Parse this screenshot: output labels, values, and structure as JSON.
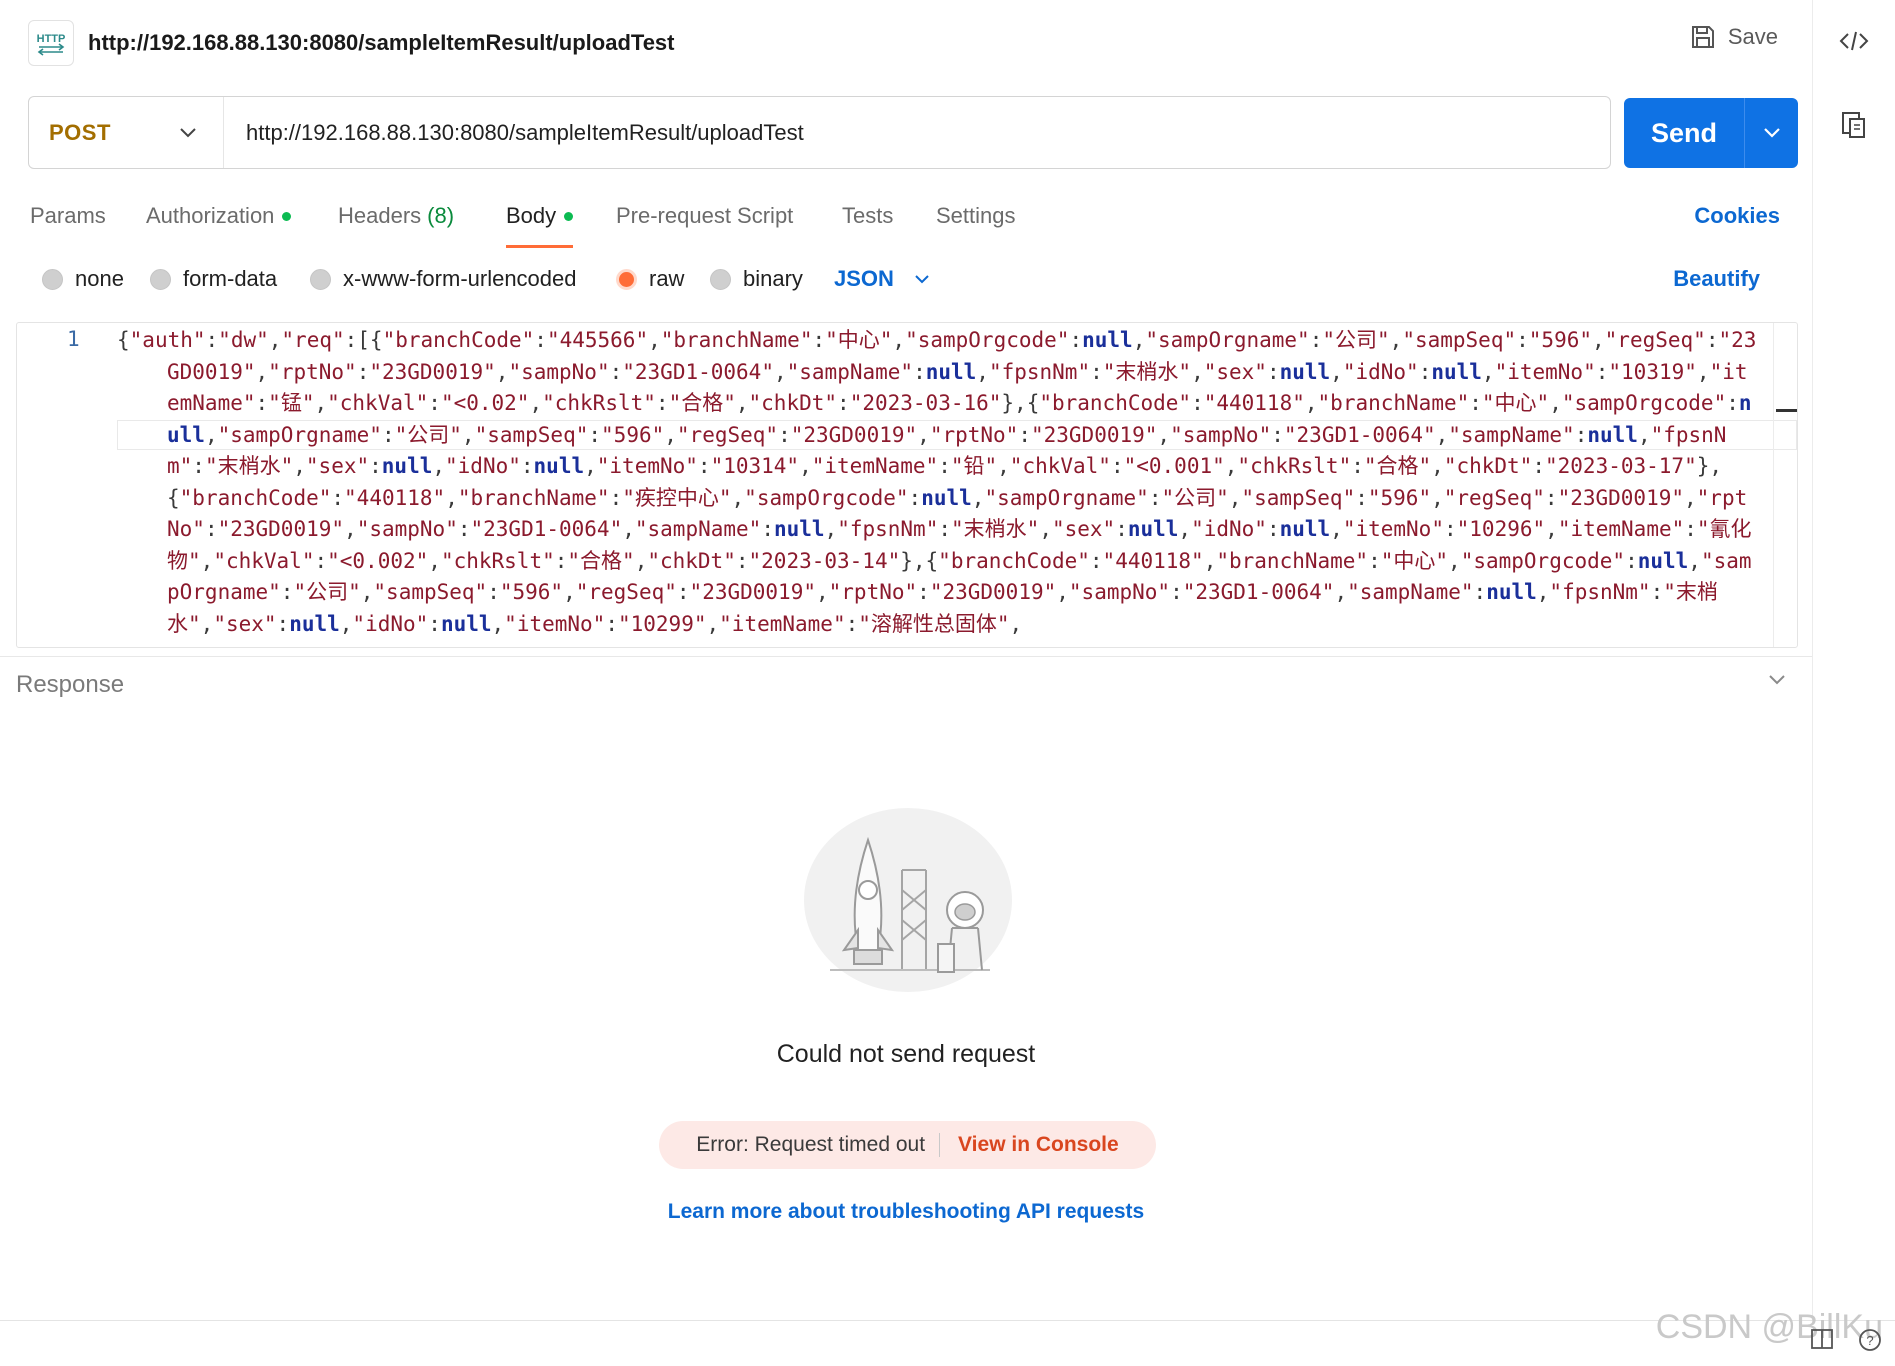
{
  "request": {
    "title": "http://192.168.88.130:8080/sampleItemResult/uploadTest",
    "badge": "HTTP",
    "save_label": "Save",
    "method": "POST",
    "url": "http://192.168.88.130:8080/sampleItemResult/uploadTest",
    "send_label": "Send"
  },
  "tabs": {
    "params": "Params",
    "authorization": "Authorization",
    "headers": "Headers",
    "headers_count": "(8)",
    "body": "Body",
    "prerequest": "Pre-request Script",
    "tests": "Tests",
    "settings": "Settings",
    "cookies": "Cookies"
  },
  "body_types": {
    "none": "none",
    "form_data": "form-data",
    "urlencoded": "x-www-form-urlencoded",
    "raw": "raw",
    "binary": "binary",
    "format": "JSON",
    "beautify": "Beautify"
  },
  "editor": {
    "line_number": "1",
    "segments": [
      {
        "t": "{",
        "c": "pn"
      },
      {
        "t": "\"auth\"",
        "c": "s"
      },
      {
        "t": ":",
        "c": "pn"
      },
      {
        "t": "\"dw\"",
        "c": "s"
      },
      {
        "t": ",",
        "c": "pn"
      },
      {
        "t": "\"req\"",
        "c": "s"
      },
      {
        "t": ":[{",
        "c": "pn"
      },
      {
        "t": "\"branchCode\"",
        "c": "s"
      },
      {
        "t": ":",
        "c": "pn"
      },
      {
        "t": "\"445566\"",
        "c": "s"
      },
      {
        "t": ",",
        "c": "pn"
      },
      {
        "t": "\"branchName\"",
        "c": "s"
      },
      {
        "t": ":",
        "c": "pn"
      },
      {
        "t": "\"中心\"",
        "c": "s"
      },
      {
        "t": ",",
        "c": "pn"
      },
      {
        "t": "\"sampOrgcode\"",
        "c": "s"
      },
      {
        "t": ":",
        "c": "pn"
      },
      {
        "t": "null",
        "c": "kw"
      },
      {
        "t": ",",
        "c": "pn"
      },
      {
        "t": "\"sampOrgname\"",
        "c": "s"
      },
      {
        "t": ":",
        "c": "pn"
      },
      {
        "t": "\"公司\"",
        "c": "s"
      },
      {
        "t": ",",
        "c": "pn"
      },
      {
        "t": "\"sampSeq\"",
        "c": "s"
      },
      {
        "t": ":",
        "c": "pn"
      },
      {
        "t": "\"596\"",
        "c": "s"
      },
      {
        "t": ",",
        "c": "pn"
      },
      {
        "t": "\"regSeq\"",
        "c": "s"
      },
      {
        "t": ":",
        "c": "pn"
      },
      {
        "t": "\"23GD0019\"",
        "c": "s"
      },
      {
        "t": ",",
        "c": "pn"
      },
      {
        "t": "\"rptNo\"",
        "c": "s"
      },
      {
        "t": ":",
        "c": "pn"
      },
      {
        "t": "\"23GD0019\"",
        "c": "s"
      },
      {
        "t": ",",
        "c": "pn"
      },
      {
        "t": "\"sampNo\"",
        "c": "s"
      },
      {
        "t": ":",
        "c": "pn"
      },
      {
        "t": "\"23GD1-0064\"",
        "c": "s"
      },
      {
        "t": ",",
        "c": "pn"
      },
      {
        "t": "\"sampName\"",
        "c": "s"
      },
      {
        "t": ":",
        "c": "pn"
      },
      {
        "t": "null",
        "c": "kw"
      },
      {
        "t": ",",
        "c": "pn"
      },
      {
        "t": "\"fpsnNm\"",
        "c": "s"
      },
      {
        "t": ":",
        "c": "pn"
      },
      {
        "t": "\"末梢水\"",
        "c": "s"
      },
      {
        "t": ",",
        "c": "pn"
      },
      {
        "t": "\"sex\"",
        "c": "s"
      },
      {
        "t": ":",
        "c": "pn"
      },
      {
        "t": "null",
        "c": "kw"
      },
      {
        "t": ",",
        "c": "pn"
      },
      {
        "t": "\"idNo\"",
        "c": "s"
      },
      {
        "t": ":",
        "c": "pn"
      },
      {
        "t": "null",
        "c": "kw"
      },
      {
        "t": ",",
        "c": "pn"
      },
      {
        "t": "\"itemNo\"",
        "c": "s"
      },
      {
        "t": ":",
        "c": "pn"
      },
      {
        "t": "\"10319\"",
        "c": "s"
      },
      {
        "t": ",",
        "c": "pn"
      },
      {
        "t": "\"itemName\"",
        "c": "s"
      },
      {
        "t": ":",
        "c": "pn"
      },
      {
        "t": "\"锰\"",
        "c": "s"
      },
      {
        "t": ",",
        "c": "pn"
      },
      {
        "t": "\"chkVal\"",
        "c": "s"
      },
      {
        "t": ":",
        "c": "pn"
      },
      {
        "t": "\"<0.02\"",
        "c": "s"
      },
      {
        "t": ",",
        "c": "pn"
      },
      {
        "t": "\"chkRslt\"",
        "c": "s"
      },
      {
        "t": ":",
        "c": "pn"
      },
      {
        "t": "\"合格\"",
        "c": "s"
      },
      {
        "t": ",",
        "c": "pn"
      },
      {
        "t": "\"chkDt\"",
        "c": "s"
      },
      {
        "t": ":",
        "c": "pn"
      },
      {
        "t": "\"2023-03-16\"",
        "c": "s"
      },
      {
        "t": "},{",
        "c": "pn"
      },
      {
        "t": "\"branchCode\"",
        "c": "s"
      },
      {
        "t": ":",
        "c": "pn"
      },
      {
        "t": "\"440118\"",
        "c": "s"
      },
      {
        "t": ",",
        "c": "pn"
      },
      {
        "t": "\"branchName\"",
        "c": "s"
      },
      {
        "t": ":",
        "c": "pn"
      },
      {
        "t": "\"中心\"",
        "c": "s"
      },
      {
        "t": ",",
        "c": "pn"
      },
      {
        "t": "\"sampOrgcode\"",
        "c": "s"
      },
      {
        "t": ":",
        "c": "pn"
      },
      {
        "t": "null",
        "c": "kw"
      },
      {
        "t": ",",
        "c": "pn"
      },
      {
        "t": "\"sampOrgname\"",
        "c": "s"
      },
      {
        "t": ":",
        "c": "pn"
      },
      {
        "t": "\"公司\"",
        "c": "s"
      },
      {
        "t": ",",
        "c": "pn"
      },
      {
        "t": "\"sampSeq\"",
        "c": "s"
      },
      {
        "t": ":",
        "c": "pn"
      },
      {
        "t": "\"596\"",
        "c": "s"
      },
      {
        "t": ",",
        "c": "pn"
      },
      {
        "t": "\"regSeq\"",
        "c": "s"
      },
      {
        "t": ":",
        "c": "pn"
      },
      {
        "t": "\"23GD0019\"",
        "c": "s"
      },
      {
        "t": ",",
        "c": "pn"
      },
      {
        "t": "\"rptNo\"",
        "c": "s"
      },
      {
        "t": ":",
        "c": "pn"
      },
      {
        "t": "\"23GD0019\"",
        "c": "s"
      },
      {
        "t": ",",
        "c": "pn"
      },
      {
        "t": "\"sampNo\"",
        "c": "s"
      },
      {
        "t": ":",
        "c": "pn"
      },
      {
        "t": "\"23GD1-0064\"",
        "c": "s"
      },
      {
        "t": ",",
        "c": "pn"
      },
      {
        "t": "\"sampName\"",
        "c": "s"
      },
      {
        "t": ":",
        "c": "pn"
      },
      {
        "t": "null",
        "c": "kw"
      },
      {
        "t": ",",
        "c": "pn"
      },
      {
        "t": "\"fpsnNm\"",
        "c": "s"
      },
      {
        "t": ":",
        "c": "pn"
      },
      {
        "t": "\"末梢水\"",
        "c": "s"
      },
      {
        "t": ",",
        "c": "pn"
      },
      {
        "t": "\"sex\"",
        "c": "s"
      },
      {
        "t": ":",
        "c": "pn"
      },
      {
        "t": "null",
        "c": "kw"
      },
      {
        "t": ",",
        "c": "pn"
      },
      {
        "t": "\"idNo\"",
        "c": "s"
      },
      {
        "t": ":",
        "c": "pn"
      },
      {
        "t": "null",
        "c": "kw"
      },
      {
        "t": ",",
        "c": "pn"
      },
      {
        "t": "\"itemNo\"",
        "c": "s"
      },
      {
        "t": ":",
        "c": "pn"
      },
      {
        "t": "\"10314\"",
        "c": "s"
      },
      {
        "t": ",",
        "c": "pn"
      },
      {
        "t": "\"itemName\"",
        "c": "s"
      },
      {
        "t": ":",
        "c": "pn"
      },
      {
        "t": "\"铅\"",
        "c": "s"
      },
      {
        "t": ",",
        "c": "pn"
      },
      {
        "t": "\"chkVal\"",
        "c": "s"
      },
      {
        "t": ":",
        "c": "pn"
      },
      {
        "t": "\"<0.001\"",
        "c": "s"
      },
      {
        "t": ",",
        "c": "pn"
      },
      {
        "t": "\"chkRslt\"",
        "c": "s"
      },
      {
        "t": ":",
        "c": "pn"
      },
      {
        "t": "\"合格\"",
        "c": "s"
      },
      {
        "t": ",",
        "c": "pn"
      },
      {
        "t": "\"chkDt\"",
        "c": "s"
      },
      {
        "t": ":",
        "c": "pn"
      },
      {
        "t": "\"2023-03-17\"",
        "c": "s"
      },
      {
        "t": "},{",
        "c": "pn"
      },
      {
        "t": "\"branchCode\"",
        "c": "s"
      },
      {
        "t": ":",
        "c": "pn"
      },
      {
        "t": "\"440118\"",
        "c": "s"
      },
      {
        "t": ",",
        "c": "pn"
      },
      {
        "t": "\"branchName\"",
        "c": "s"
      },
      {
        "t": ":",
        "c": "pn"
      },
      {
        "t": "\"疾控中心\"",
        "c": "s"
      },
      {
        "t": ",",
        "c": "pn"
      },
      {
        "t": "\"sampOrgcode\"",
        "c": "s"
      },
      {
        "t": ":",
        "c": "pn"
      },
      {
        "t": "null",
        "c": "kw"
      },
      {
        "t": ",",
        "c": "pn"
      },
      {
        "t": "\"sampOrgname\"",
        "c": "s"
      },
      {
        "t": ":",
        "c": "pn"
      },
      {
        "t": "\"公司\"",
        "c": "s"
      },
      {
        "t": ",",
        "c": "pn"
      },
      {
        "t": "\"sampSeq\"",
        "c": "s"
      },
      {
        "t": ":",
        "c": "pn"
      },
      {
        "t": "\"596\"",
        "c": "s"
      },
      {
        "t": ",",
        "c": "pn"
      },
      {
        "t": "\"regSeq\"",
        "c": "s"
      },
      {
        "t": ":",
        "c": "pn"
      },
      {
        "t": "\"23GD0019\"",
        "c": "s"
      },
      {
        "t": ",",
        "c": "pn"
      },
      {
        "t": "\"rptNo\"",
        "c": "s"
      },
      {
        "t": ":",
        "c": "pn"
      },
      {
        "t": "\"23GD0019\"",
        "c": "s"
      },
      {
        "t": ",",
        "c": "pn"
      },
      {
        "t": "\"sampNo\"",
        "c": "s"
      },
      {
        "t": ":",
        "c": "pn"
      },
      {
        "t": "\"23GD1-0064\"",
        "c": "s"
      },
      {
        "t": ",",
        "c": "pn"
      },
      {
        "t": "\"sampName\"",
        "c": "s"
      },
      {
        "t": ":",
        "c": "pn"
      },
      {
        "t": "null",
        "c": "kw"
      },
      {
        "t": ",",
        "c": "pn"
      },
      {
        "t": "\"fpsnNm\"",
        "c": "s"
      },
      {
        "t": ":",
        "c": "pn"
      },
      {
        "t": "\"末梢水\"",
        "c": "s"
      },
      {
        "t": ",",
        "c": "pn"
      },
      {
        "t": "\"sex\"",
        "c": "s"
      },
      {
        "t": ":",
        "c": "pn"
      },
      {
        "t": "null",
        "c": "kw"
      },
      {
        "t": ",",
        "c": "pn"
      },
      {
        "t": "\"idNo\"",
        "c": "s"
      },
      {
        "t": ":",
        "c": "pn"
      },
      {
        "t": "null",
        "c": "kw"
      },
      {
        "t": ",",
        "c": "pn"
      },
      {
        "t": "\"itemNo\"",
        "c": "s"
      },
      {
        "t": ":",
        "c": "pn"
      },
      {
        "t": "\"10296\"",
        "c": "s"
      },
      {
        "t": ",",
        "c": "pn"
      },
      {
        "t": "\"itemName\"",
        "c": "s"
      },
      {
        "t": ":",
        "c": "pn"
      },
      {
        "t": "\"氰化物\"",
        "c": "s"
      },
      {
        "t": ",",
        "c": "pn"
      },
      {
        "t": "\"chkVal\"",
        "c": "s"
      },
      {
        "t": ":",
        "c": "pn"
      },
      {
        "t": "\"<0.002\"",
        "c": "s"
      },
      {
        "t": ",",
        "c": "pn"
      },
      {
        "t": "\"chkRslt\"",
        "c": "s"
      },
      {
        "t": ":",
        "c": "pn"
      },
      {
        "t": "\"合格\"",
        "c": "s"
      },
      {
        "t": ",",
        "c": "pn"
      },
      {
        "t": "\"chkDt\"",
        "c": "s"
      },
      {
        "t": ":",
        "c": "pn"
      },
      {
        "t": "\"2023-03-14\"",
        "c": "s"
      },
      {
        "t": "},{",
        "c": "pn"
      },
      {
        "t": "\"branchCode\"",
        "c": "s"
      },
      {
        "t": ":",
        "c": "pn"
      },
      {
        "t": "\"440118\"",
        "c": "s"
      },
      {
        "t": ",",
        "c": "pn"
      },
      {
        "t": "\"branchName\"",
        "c": "s"
      },
      {
        "t": ":",
        "c": "pn"
      },
      {
        "t": "\"中心\"",
        "c": "s"
      },
      {
        "t": ",",
        "c": "pn"
      },
      {
        "t": "\"sampOrgcode\"",
        "c": "s"
      },
      {
        "t": ":",
        "c": "pn"
      },
      {
        "t": "null",
        "c": "kw"
      },
      {
        "t": ",",
        "c": "pn"
      },
      {
        "t": "\"sampOrgname\"",
        "c": "s"
      },
      {
        "t": ":",
        "c": "pn"
      },
      {
        "t": "\"公司\"",
        "c": "s"
      },
      {
        "t": ",",
        "c": "pn"
      },
      {
        "t": "\"sampSeq\"",
        "c": "s"
      },
      {
        "t": ":",
        "c": "pn"
      },
      {
        "t": "\"596\"",
        "c": "s"
      },
      {
        "t": ",",
        "c": "pn"
      },
      {
        "t": "\"regSeq\"",
        "c": "s"
      },
      {
        "t": ":",
        "c": "pn"
      },
      {
        "t": "\"23GD0019\"",
        "c": "s"
      },
      {
        "t": ",",
        "c": "pn"
      },
      {
        "t": "\"rptNo\"",
        "c": "s"
      },
      {
        "t": ":",
        "c": "pn"
      },
      {
        "t": "\"23GD0019\"",
        "c": "s"
      },
      {
        "t": ",",
        "c": "pn"
      },
      {
        "t": "\"sampNo\"",
        "c": "s"
      },
      {
        "t": ":",
        "c": "pn"
      },
      {
        "t": "\"23GD1-0064\"",
        "c": "s"
      },
      {
        "t": ",",
        "c": "pn"
      },
      {
        "t": "\"sampName\"",
        "c": "s"
      },
      {
        "t": ":",
        "c": "pn"
      },
      {
        "t": "null",
        "c": "kw"
      },
      {
        "t": ",",
        "c": "pn"
      },
      {
        "t": "\"fpsnNm\"",
        "c": "s"
      },
      {
        "t": ":",
        "c": "pn"
      },
      {
        "t": "\"末梢水\"",
        "c": "s"
      },
      {
        "t": ",",
        "c": "pn"
      },
      {
        "t": "\"sex\"",
        "c": "s"
      },
      {
        "t": ":",
        "c": "pn"
      },
      {
        "t": "null",
        "c": "kw"
      },
      {
        "t": ",",
        "c": "pn"
      },
      {
        "t": "\"idNo\"",
        "c": "s"
      },
      {
        "t": ":",
        "c": "pn"
      },
      {
        "t": "null",
        "c": "kw"
      },
      {
        "t": ",",
        "c": "pn"
      },
      {
        "t": "\"itemNo\"",
        "c": "s"
      },
      {
        "t": ":",
        "c": "pn"
      },
      {
        "t": "\"10299\"",
        "c": "s"
      },
      {
        "t": ",",
        "c": "pn"
      },
      {
        "t": "\"itemName\"",
        "c": "s"
      },
      {
        "t": ":",
        "c": "pn"
      },
      {
        "t": "\"溶解性总固体\"",
        "c": "s"
      },
      {
        "t": ",",
        "c": "pn"
      }
    ]
  },
  "response": {
    "title": "Response",
    "error_title": "Could not send request",
    "error_message": "Error: Request timed out",
    "console_link": "View in Console",
    "learn_more": "Learn more about troubleshooting API requests"
  },
  "watermark": "CSDN @BillKu",
  "colors": {
    "accent": "#ff6c37",
    "send": "#0f72e4",
    "link": "#0c68d1",
    "method": "#a36e00",
    "error_link": "#d9461f",
    "dot": "#0cbb52"
  }
}
